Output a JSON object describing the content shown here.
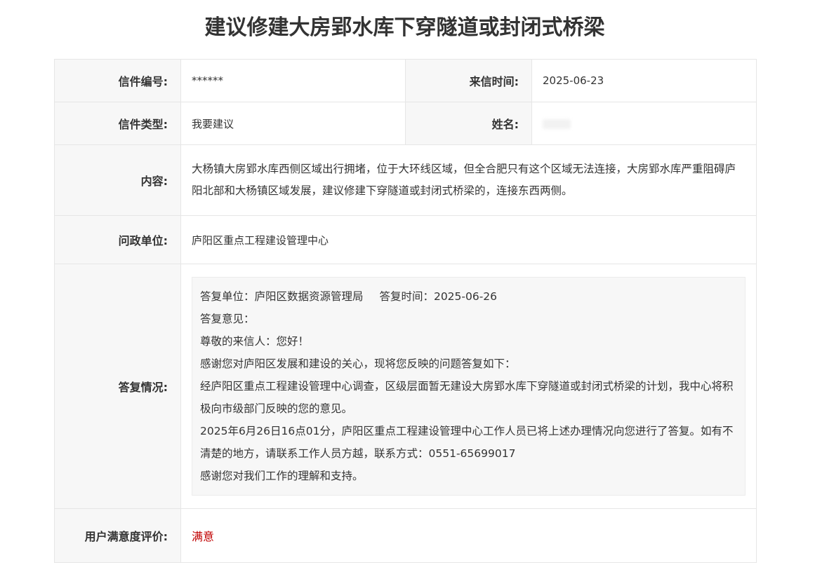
{
  "title": "建议修建大房郢水库下穿隧道或封闭式桥梁",
  "fields": {
    "letter_no_label": "信件编号:",
    "letter_no_value": "******",
    "date_label": "来信时间:",
    "date_value": "2025-06-23",
    "type_label": "信件类型:",
    "type_value": "我要建议",
    "name_label": "姓名:",
    "content_label": "内容:",
    "content_value": "大杨镇大房郢水库西侧区域出行拥堵，位于大环线区域，但全合肥只有这个区域无法连接，大房郢水库严重阻碍庐阳北部和大杨镇区域发展，建议修建下穿隧道或封闭式桥梁的，连接东西两侧。",
    "unit_label": "问政单位:",
    "unit_value": "庐阳区重点工程建设管理中心",
    "reply_label": "答复情况:",
    "rating_label": "用户满意度评价:",
    "rating_value": "满意"
  },
  "reply": {
    "unit": "答复单位：庐阳区数据资源管理局",
    "time": "答复时间：2025-06-26",
    "opinion_label": "答复意见：",
    "greeting": "尊敬的来信人：您好！",
    "line1": "感谢您对庐阳区发展和建设的关心，现将您反映的问题答复如下：",
    "line2": "经庐阳区重点工程建设管理中心调查，区级层面暂无建设大房郢水库下穿隧道或封闭式桥梁的计划，我中心将积极向市级部门反映的您的意见。",
    "line3": "2025年6月26日16点01分，庐阳区重点工程建设管理中心工作人员已将上述办理情况向您进行了答复。如有不清楚的地方，请联系工作人员方越，联系方式：0551-65699017",
    "line4": "感谢您对我们工作的理解和支持。"
  },
  "colors": {
    "label_bg": "#f7f7f7",
    "border": "#e6e6e6",
    "satisfied": "#c00000"
  }
}
